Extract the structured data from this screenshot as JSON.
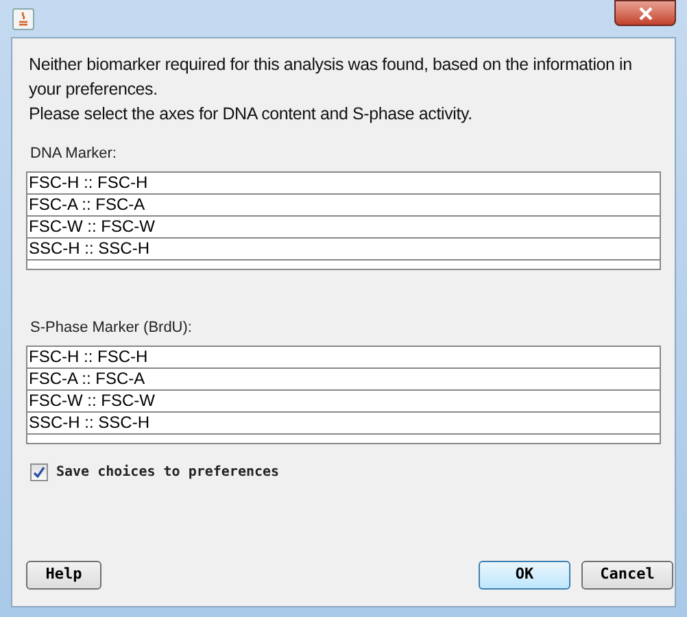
{
  "message": [
    "Neither biomarker required for this analysis was found, based on the information in your preferences.",
    "Please select the axes for DNA content and S-phase activity."
  ],
  "lists": [
    {
      "label": "DNA Marker:",
      "items": [
        "FSC-H :: FSC-H",
        "FSC-A :: FSC-A",
        "FSC-W :: FSC-W",
        "SSC-H :: SSC-H"
      ]
    },
    {
      "label": "S-Phase Marker (BrdU):",
      "items": [
        "FSC-H :: FSC-H",
        "FSC-A :: FSC-A",
        "FSC-W :: FSC-W",
        "SSC-H :: SSC-H"
      ]
    }
  ],
  "save_choices": {
    "label": "Save choices to preferences",
    "checked": true
  },
  "buttons": [
    {
      "label": "Help",
      "default": false
    },
    {
      "label": "OK",
      "default": true
    },
    {
      "label": "Cancel",
      "default": false
    }
  ]
}
